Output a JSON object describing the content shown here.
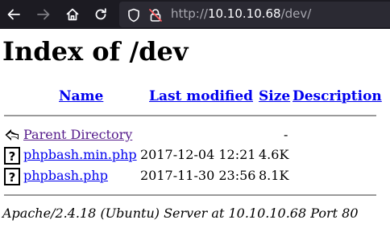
{
  "browser": {
    "url_protocol": "http://",
    "url_host": "10.10.10.68",
    "url_path": "/dev/"
  },
  "page": {
    "title": "Index of /dev",
    "columns": {
      "name": "Name",
      "last_modified": "Last modified",
      "size": "Size",
      "description": "Description"
    },
    "rows": [
      {
        "icon": "back-icon",
        "name": "Parent Directory",
        "last_modified": "",
        "size": "-",
        "description": ""
      },
      {
        "icon": "unknown-file-icon",
        "name": "phpbash.min.php",
        "last_modified": "2017-12-04 12:21",
        "size": "4.6K",
        "description": ""
      },
      {
        "icon": "unknown-file-icon",
        "name": "phpbash.php",
        "last_modified": "2017-11-30 23:56",
        "size": "8.1K",
        "description": ""
      }
    ],
    "address": "Apache/2.4.18 (Ubuntu) Server at 10.10.10.68 Port 80"
  }
}
